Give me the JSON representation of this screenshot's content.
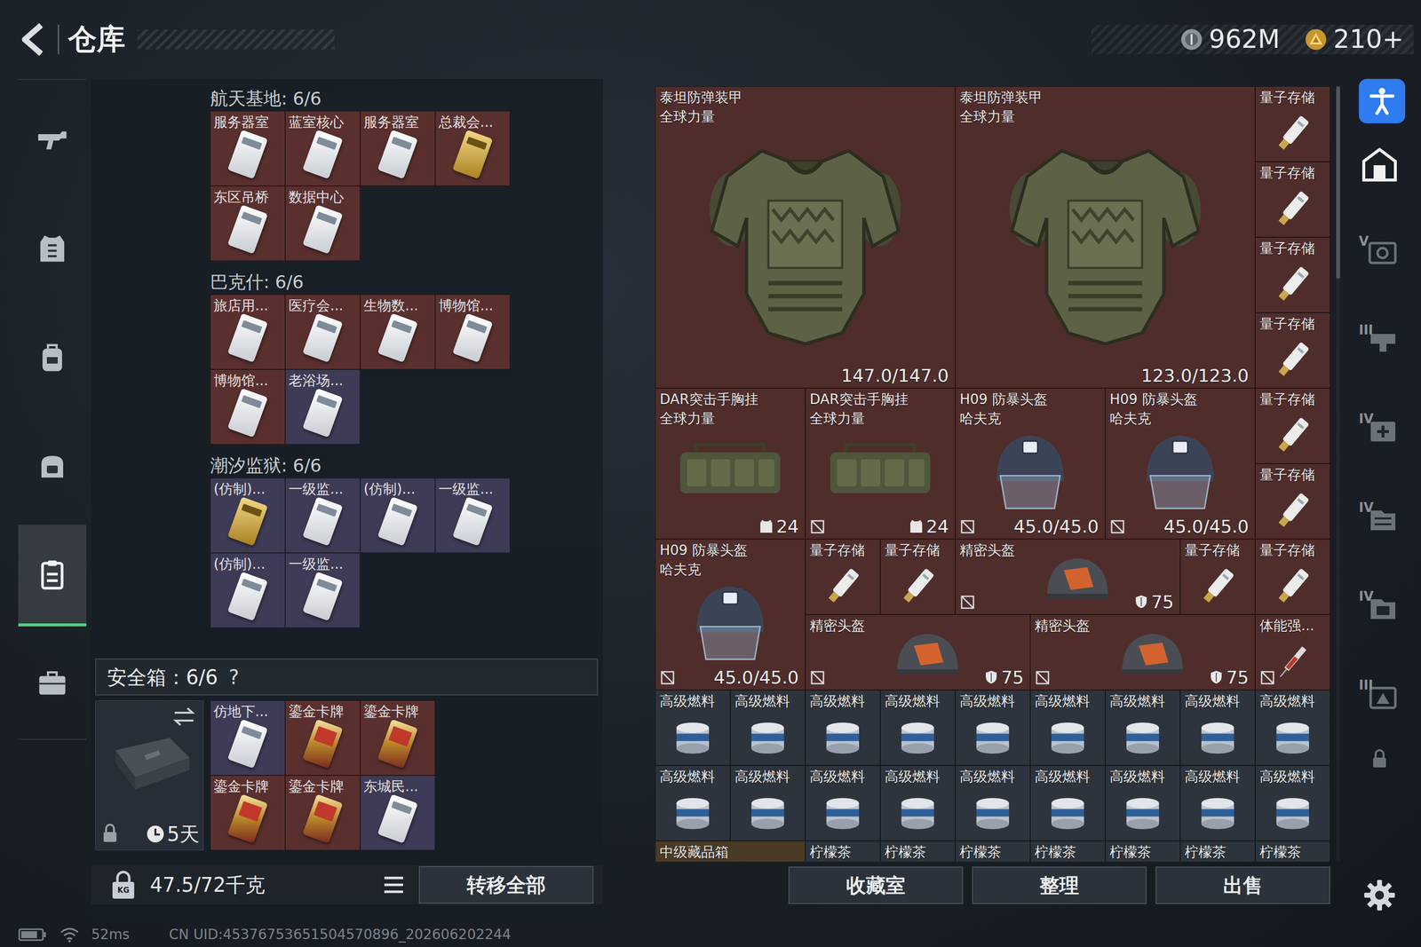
{
  "header": {
    "title": "仓库",
    "currencies": [
      {
        "amount": "962M"
      },
      {
        "amount": "210+"
      }
    ]
  },
  "nav": [
    {
      "selected": false
    },
    {
      "selected": false
    },
    {
      "selected": false
    },
    {
      "selected": false
    },
    {
      "selected": true
    },
    {
      "selected": false
    }
  ],
  "key_groups": [
    {
      "title": "航天基地: 6/6",
      "cards": [
        {
          "label": "服务器室",
          "kind": "white",
          "color": "#5a302e"
        },
        {
          "label": "蓝室核心",
          "kind": "white",
          "color": "#5a302e"
        },
        {
          "label": "服务器室",
          "kind": "white",
          "color": "#5a302e"
        },
        {
          "label": "总裁会...",
          "kind": "gold",
          "color": "#5a302e"
        },
        {
          "label": "东区吊桥",
          "kind": "white",
          "color": "#5a302e"
        },
        {
          "label": "数据中心",
          "kind": "white",
          "color": "#5a302e"
        }
      ]
    },
    {
      "title": "巴克什: 6/6",
      "cards": [
        {
          "label": "旅店用...",
          "kind": "white",
          "color": "#5a302e"
        },
        {
          "label": "医疗会...",
          "kind": "white",
          "color": "#5a302e"
        },
        {
          "label": "生物数...",
          "kind": "white",
          "color": "#5a302e"
        },
        {
          "label": "博物馆...",
          "kind": "white",
          "color": "#5a302e"
        },
        {
          "label": "博物馆...",
          "kind": "white",
          "color": "#5a302e"
        },
        {
          "label": "老浴场...",
          "kind": "white",
          "color": "#3e3b56"
        }
      ]
    },
    {
      "title": "潮汐监狱: 6/6",
      "cards": [
        {
          "label": "(仿制)...",
          "kind": "gold",
          "color": "#3e3b56"
        },
        {
          "label": "一级监...",
          "kind": "white",
          "color": "#3e3b56"
        },
        {
          "label": "(仿制)...",
          "kind": "white",
          "color": "#3e3b56"
        },
        {
          "label": "一级监...",
          "kind": "white",
          "color": "#3e3b56"
        },
        {
          "label": "(仿制)...",
          "kind": "white",
          "color": "#3e3b56"
        },
        {
          "label": "一级监...",
          "kind": "white",
          "color": "#3e3b56"
        }
      ]
    }
  ],
  "safe": {
    "title": "安全箱：6/6",
    "help": "?",
    "timer": "5天",
    "cards": [
      {
        "label": "仿地下...",
        "kind": "white",
        "color": "#3e3b56"
      },
      {
        "label": "鎏金卡牌",
        "kind": "ornate",
        "color": "#5a302e"
      },
      {
        "label": "鎏金卡牌",
        "kind": "ornate",
        "color": "#5a302e"
      },
      {
        "label": "鎏金卡牌",
        "kind": "ornate",
        "color": "#5a302e"
      },
      {
        "label": "鎏金卡牌",
        "kind": "ornate",
        "color": "#5a302e"
      },
      {
        "label": "东城民...",
        "kind": "white",
        "color": "#3e3b56"
      }
    ]
  },
  "footer": {
    "weight_icon": "KG",
    "weight": "47.5/72千克",
    "transfer": "转移全部"
  },
  "stash": {
    "items": [
      {
        "name": "泰坦防弹装甲",
        "brand": "全球力量",
        "reading": "147.0/147.0",
        "kind": "armor",
        "color": "#4f2d2b",
        "marked": false
      },
      {
        "name": "泰坦防弹装甲",
        "brand": "全球力量",
        "reading": "123.0/123.0",
        "kind": "armor",
        "color": "#4f2d2b",
        "marked": false
      },
      {
        "name": "量子存储",
        "kind": "storage",
        "color": "#4f2d2b",
        "marked": false
      },
      {
        "name": "量子存储",
        "kind": "storage",
        "color": "#4f2d2b",
        "marked": false
      },
      {
        "name": "量子存储",
        "kind": "storage",
        "color": "#4f2d2b",
        "marked": false
      },
      {
        "name": "量子存储",
        "kind": "storage",
        "color": "#4f2d2b",
        "marked": false
      },
      {
        "name": "DAR突击手胸挂",
        "brand": "全球力量",
        "reading": "24",
        "kind": "rig",
        "color": "#4f2d2b",
        "marked": false
      },
      {
        "name": "DAR突击手胸挂",
        "brand": "全球力量",
        "reading": "24",
        "kind": "rig",
        "color": "#4f2d2b",
        "marked": true
      },
      {
        "name": "H09 防暴头盔",
        "brand": "哈夫克",
        "reading": "45.0/45.0",
        "kind": "helmet",
        "color": "#4f2d2b",
        "marked": true
      },
      {
        "name": "H09 防暴头盔",
        "brand": "哈夫克",
        "reading": "45.0/45.0",
        "kind": "helmet",
        "color": "#4f2d2b",
        "marked": true
      },
      {
        "name": "量子存储",
        "kind": "storage",
        "color": "#4f2d2b",
        "marked": false
      },
      {
        "name": "量子存储",
        "kind": "storage",
        "color": "#4f2d2b",
        "marked": false
      },
      {
        "name": "H09 防暴头盔",
        "brand": "哈夫克",
        "reading": "45.0/45.0",
        "kind": "helmet",
        "color": "#4f2d2b",
        "marked": true
      },
      {
        "name": "量子存储",
        "kind": "storage",
        "color": "#4f2d2b",
        "marked": false
      },
      {
        "name": "量子存储",
        "kind": "storage",
        "color": "#4f2d2b",
        "marked": false
      },
      {
        "name": "精密头盔",
        "reading": "75",
        "kind": "precision",
        "color": "#4f2d2b",
        "marked": true
      },
      {
        "name": "量子存储",
        "kind": "storage",
        "color": "#4f2d2b",
        "marked": false
      },
      {
        "name": "量子存储",
        "kind": "storage",
        "color": "#4f2d2b",
        "marked": false
      },
      {
        "name": "精密头盔",
        "reading": "75",
        "kind": "precision",
        "color": "#4f2d2b",
        "marked": true
      },
      {
        "name": "精密头盔",
        "reading": "75",
        "kind": "precision",
        "color": "#4f2d2b",
        "marked": true
      },
      {
        "name": "体能强...",
        "kind": "syringe",
        "color": "#4f2d2b",
        "marked": true
      },
      {
        "name": "高级燃料",
        "kind": "fuel",
        "color": "#2e343d",
        "marked": false
      },
      {
        "name": "高级燃料",
        "kind": "fuel",
        "color": "#2e343d",
        "marked": false
      },
      {
        "name": "高级燃料",
        "kind": "fuel",
        "color": "#2e343d",
        "marked": false
      },
      {
        "name": "高级燃料",
        "kind": "fuel",
        "color": "#2e343d",
        "marked": false
      },
      {
        "name": "高级燃料",
        "kind": "fuel",
        "color": "#2e343d",
        "marked": false
      },
      {
        "name": "高级燃料",
        "kind": "fuel",
        "color": "#2e343d",
        "marked": false
      },
      {
        "name": "高级燃料",
        "kind": "fuel",
        "color": "#2e343d",
        "marked": false
      },
      {
        "name": "高级燃料",
        "kind": "fuel",
        "color": "#2e343d",
        "marked": false
      },
      {
        "name": "高级燃料",
        "kind": "fuel",
        "color": "#2e343d",
        "marked": false
      },
      {
        "name": "高级燃料",
        "kind": "fuel",
        "color": "#2e343d",
        "marked": false
      },
      {
        "name": "高级燃料",
        "kind": "fuel",
        "color": "#2e343d",
        "marked": false
      },
      {
        "name": "高级燃料",
        "kind": "fuel",
        "color": "#2e343d",
        "marked": false
      },
      {
        "name": "高级燃料",
        "kind": "fuel",
        "color": "#2e343d",
        "marked": false
      },
      {
        "name": "高级燃料",
        "kind": "fuel",
        "color": "#2e343d",
        "marked": false
      },
      {
        "name": "高级燃料",
        "kind": "fuel",
        "color": "#2e343d",
        "marked": false
      },
      {
        "name": "高级燃料",
        "kind": "fuel",
        "color": "#2e343d",
        "marked": false
      },
      {
        "name": "高级燃料",
        "kind": "fuel",
        "color": "#2e343d",
        "marked": false
      },
      {
        "name": "高级燃料",
        "kind": "fuel",
        "color": "#2e343d",
        "marked": false
      },
      {
        "name": "中级藏品箱",
        "kind": "crate",
        "color": "#4a3b27",
        "marked": false
      },
      {
        "name": "柠檬茶",
        "kind": "drink",
        "color": "#2e343d",
        "marked": false
      },
      {
        "name": "柠檬茶",
        "kind": "drink",
        "color": "#2e343d",
        "marked": false
      },
      {
        "name": "柠檬茶",
        "kind": "drink",
        "color": "#2e343d",
        "marked": false
      },
      {
        "name": "柠檬茶",
        "kind": "drink",
        "color": "#2e343d",
        "marked": false
      },
      {
        "name": "柠檬茶",
        "kind": "drink",
        "color": "#2e343d",
        "marked": false
      },
      {
        "name": "柠檬茶",
        "kind": "drink",
        "color": "#2e343d",
        "marked": false
      },
      {
        "name": "柠檬茶",
        "kind": "drink",
        "color": "#2e343d",
        "marked": false
      }
    ],
    "buttons": [
      "收藏室",
      "整理",
      "出售"
    ]
  },
  "side": {
    "items": [
      {
        "selected": true
      },
      {
        "badge": "V",
        "selected": false
      },
      {
        "badge": "III",
        "selected": false
      },
      {
        "badge": "IV",
        "selected": false
      },
      {
        "badge": "IV",
        "selected": false
      },
      {
        "badge": "IV",
        "selected": false
      },
      {
        "badge": "III",
        "selected": false
      }
    ]
  },
  "status": {
    "ping": "52ms",
    "uid": "CN UID:45376753651504570896_202606202244"
  }
}
